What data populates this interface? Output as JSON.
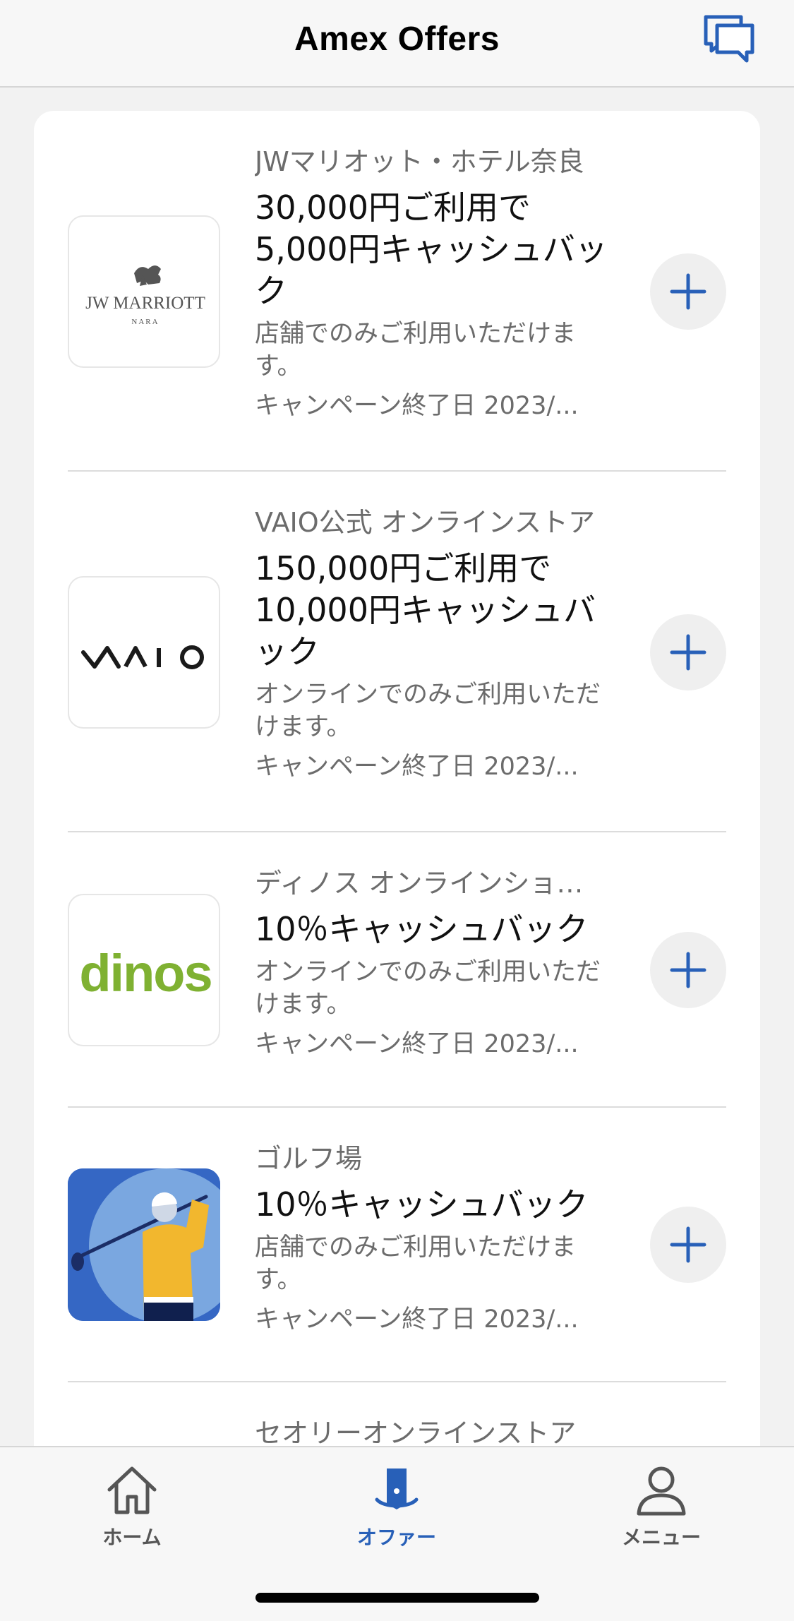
{
  "header": {
    "title": "Amex Offers"
  },
  "icons": {
    "chat": "chat-bubbles-icon",
    "add": "plus-icon",
    "home": "home-icon",
    "offers": "offer-tag-icon",
    "menu": "person-icon"
  },
  "colors": {
    "accent": "#2860b8",
    "dinos_green": "#7fb132",
    "golf_blue": "#3567c4",
    "golf_shirt": "#f2b72e"
  },
  "offers": [
    {
      "merchant": "JWマリオット・ホテル奈良",
      "headline": "30,000円ご利用で5,000円キャッシュバック",
      "description": "店舗でのみご利用いただけます。",
      "end_date": "キャンペーン終了日 2023/...",
      "logo": {
        "line1": "JW MARRIOTT",
        "line2": "NARA"
      }
    },
    {
      "merchant": "VAIO公式 オンラインストア",
      "headline": "150,000円ご利用で10,000円キャッシュバック",
      "description": "オンラインでのみご利用いただけます。",
      "end_date": "キャンペーン終了日 2023/...",
      "logo": {
        "text": "VAIO"
      }
    },
    {
      "merchant": "ディノス オンラインショップ",
      "headline": "10％キャッシュバック",
      "description": "オンラインでのみご利用いただけます。",
      "end_date": "キャンペーン終了日 2023/...",
      "logo": {
        "text": "dinos"
      }
    },
    {
      "merchant": "ゴルフ場",
      "headline": "10％キャッシュバック",
      "description": "店舗でのみご利用いただけます。",
      "end_date": "キャンペーン終了日 2023/...",
      "logo": {
        "text": ""
      }
    },
    {
      "merchant": "セオリーオンラインストア"
    }
  ],
  "tabs": [
    {
      "label": "ホーム"
    },
    {
      "label": "オファー",
      "active": true
    },
    {
      "label": "メニュー"
    }
  ]
}
